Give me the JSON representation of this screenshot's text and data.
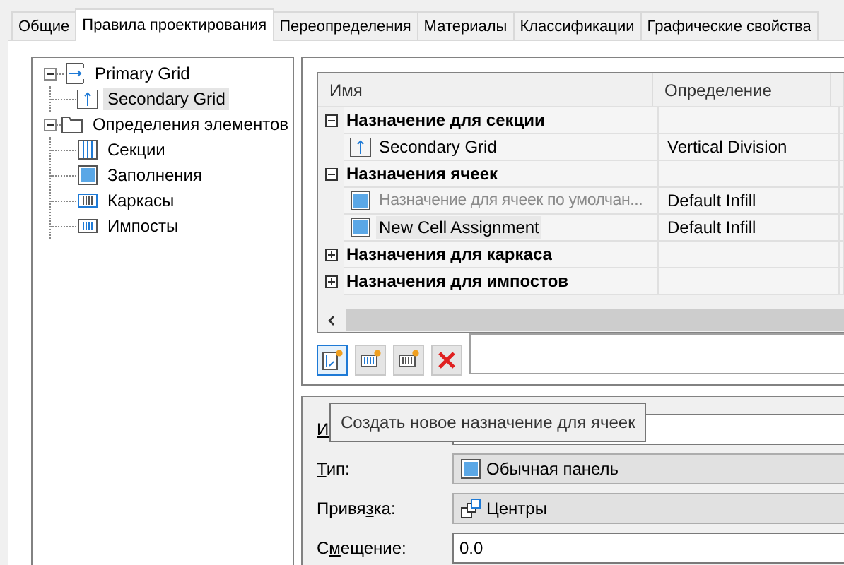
{
  "tabs": [
    {
      "label": "Общие",
      "selected": false
    },
    {
      "label": "Правила проектирования",
      "selected": true
    },
    {
      "label": "Переопределения",
      "selected": false
    },
    {
      "label": "Материалы",
      "selected": false
    },
    {
      "label": "Классификации",
      "selected": false
    },
    {
      "label": "Графические свойства",
      "selected": false
    }
  ],
  "tree": [
    {
      "label": "Primary Grid",
      "kind": "grid-horizontal",
      "expanded": true,
      "selected": false,
      "children": [
        {
          "label": "Secondary Grid",
          "kind": "grid-vertical",
          "selected": true
        }
      ]
    },
    {
      "label": "Определения элементов",
      "kind": "folder",
      "expanded": true,
      "selected": false,
      "children": [
        {
          "label": "Секции",
          "kind": "division",
          "selected": false
        },
        {
          "label": "Заполнения",
          "kind": "infill",
          "selected": false
        },
        {
          "label": "Каркасы",
          "kind": "frame",
          "selected": false
        },
        {
          "label": "Импосты",
          "kind": "mullion",
          "selected": false
        }
      ]
    }
  ],
  "table": {
    "columns": [
      "Имя",
      "Определение"
    ],
    "rows": [
      {
        "kind": "group",
        "name": "Назначение для секции",
        "expanded": true
      },
      {
        "kind": "grid",
        "name": "Secondary Grid",
        "definition": "Vertical Division",
        "disabled": false,
        "selected": false
      },
      {
        "kind": "group",
        "name": "Назначения ячеек",
        "expanded": true
      },
      {
        "kind": "infill",
        "name": "Назначение для ячеек по умолчан...",
        "definition": "Default Infill",
        "disabled": true,
        "selected": false
      },
      {
        "kind": "infill",
        "name": "New Cell Assignment",
        "definition": "Default Infill",
        "disabled": false,
        "selected": true
      },
      {
        "kind": "group",
        "name": "Назначения для каркаса",
        "expanded": false
      },
      {
        "kind": "group",
        "name": "Назначения для импостов",
        "expanded": false
      }
    ]
  },
  "toolbar": [
    {
      "kind": "new-cell",
      "active": true
    },
    {
      "kind": "new-frame",
      "active": false
    },
    {
      "kind": "new-mullion",
      "active": false
    },
    {
      "kind": "delete",
      "active": false
    }
  ],
  "properties": [
    {
      "kind": "text",
      "label": [
        {
          "text": "И",
          "underline": true
        }
      ]
    },
    {
      "kind": "infill",
      "label": [
        {
          "text": "Т",
          "underline": true
        },
        {
          "text": "ип:",
          "underline": false
        }
      ],
      "value": "Обычная панель"
    },
    {
      "kind": "centers",
      "label": [
        {
          "text": "Привя",
          "underline": false
        },
        {
          "text": "з",
          "underline": true
        },
        {
          "text": "ка:",
          "underline": false
        }
      ],
      "value": "Центры"
    },
    {
      "kind": "text",
      "label": [
        {
          "text": "С",
          "underline": false
        },
        {
          "text": "м",
          "underline": true
        },
        {
          "text": "ещение:",
          "underline": false
        }
      ],
      "value": "0.0"
    }
  ],
  "tooltip": "Создать новое назначение для ячеек"
}
